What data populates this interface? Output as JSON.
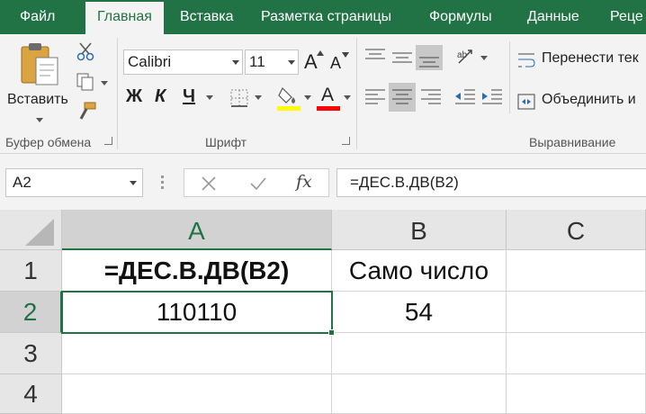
{
  "tabs": [
    {
      "label": "Файл",
      "active": false
    },
    {
      "label": "Главная",
      "active": true
    },
    {
      "label": "Вставка",
      "active": false
    },
    {
      "label": "Разметка страницы",
      "active": false
    },
    {
      "label": "Формулы",
      "active": false
    },
    {
      "label": "Данные",
      "active": false
    },
    {
      "label": "Реце",
      "active": false
    }
  ],
  "ribbon": {
    "clipboard": {
      "paste_label": "Вставить",
      "group_label": "Буфер обмена"
    },
    "font": {
      "font_name": "Calibri",
      "font_size": "11",
      "bold": "Ж",
      "italic": "К",
      "underline": "Ч",
      "increase_size": "A",
      "decrease_size": "A",
      "font_color_letter": "A",
      "group_label": "Шрифт",
      "highlight_color": "#ffff00",
      "font_color": "#ff0000"
    },
    "alignment": {
      "wrap_text_label": "Перенести тек",
      "merge_label": "Объединить и",
      "group_label": "Выравнивание"
    }
  },
  "formula_bar": {
    "name_box": "A2",
    "fx_label": "fx",
    "formula": "=ДЕС.В.ДВ(B2)"
  },
  "grid": {
    "columns": [
      "A",
      "B",
      "C"
    ],
    "rows": [
      "1",
      "2",
      "3",
      "4"
    ],
    "cells": {
      "A1": "=ДЕС.В.ДВ(B2)",
      "B1": "Само число",
      "A2": "110110",
      "B2": "54"
    },
    "selected_cell": "A2"
  },
  "colors": {
    "accent": "#217346",
    "ribbon_bg": "#f3f3f3",
    "header_bg": "#e6e6e6"
  }
}
